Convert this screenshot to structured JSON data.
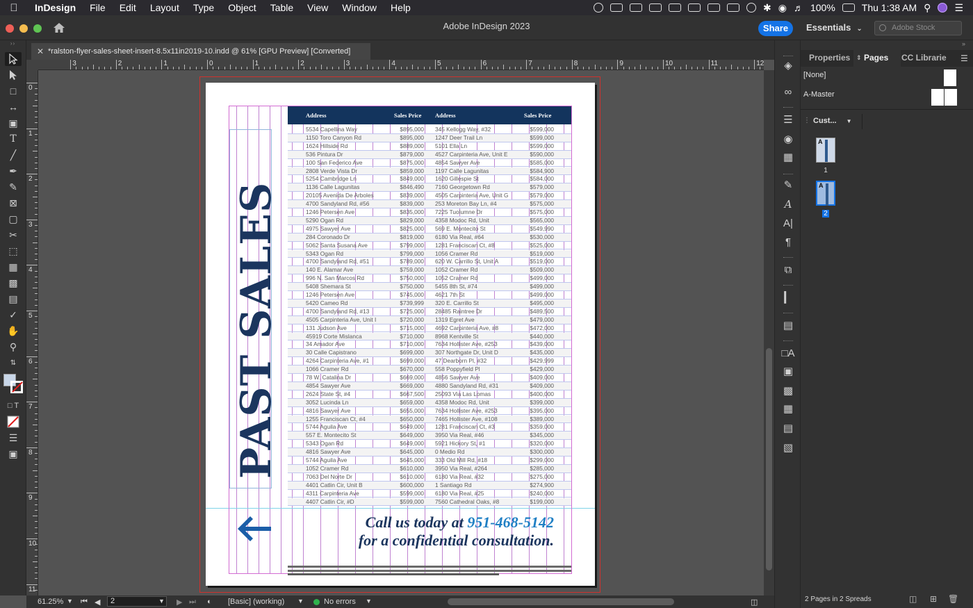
{
  "menubar": {
    "app_name": "InDesign",
    "items": [
      "File",
      "Edit",
      "Layout",
      "Type",
      "Object",
      "Table",
      "View",
      "Window",
      "Help"
    ],
    "battery": "100%",
    "clock": "Thu 1:38 AM"
  },
  "titlebar": {
    "title": "Adobe InDesign 2023",
    "share_label": "Share",
    "workspace": "Essentials",
    "stock_placeholder": "Adobe Stock"
  },
  "document": {
    "tab_title": "*ralston-flyer-sales-sheet-insert-8.5x11in2019-10.indd @ 61% [GPU Preview] [Converted]"
  },
  "rulers": {
    "horizontal_labels": [
      "3",
      "2",
      "1",
      "0",
      "1",
      "2",
      "3",
      "4",
      "5",
      "6",
      "7",
      "8",
      "9",
      "10",
      "11",
      "12"
    ],
    "vertical_labels": [
      "0",
      "1",
      "2",
      "3",
      "4",
      "5",
      "6",
      "7",
      "8",
      "9",
      "10",
      "11"
    ]
  },
  "flyer": {
    "heading": "PAST SALES",
    "table_headers": [
      "Address",
      "Sales Price",
      "Address",
      "Sales Price"
    ],
    "rows": [
      [
        "5534 Capellina Way",
        "$895,000",
        "345 Kellogg Way, #32",
        "$599,000"
      ],
      [
        "1150 Toro Canyon Rd",
        "$895,000",
        "1247 Deer Trail Ln",
        "$599,000"
      ],
      [
        "1624 Hillside Rd",
        "$889,000",
        "5101 Ella Ln",
        "$599,000"
      ],
      [
        "536 Pintura Dr",
        "$879,000",
        "4527 Carpinteria Ave, Unit E",
        "$590,000"
      ],
      [
        "100 San Federico Ave",
        "$875,000",
        "4854 Sawyer Ave",
        "$585,000"
      ],
      [
        "2808 Verde Vista Dr",
        "$859,000",
        "1197 Calle Lagunitas",
        "$584,900"
      ],
      [
        "5254 Cambridge Ln",
        "$849,000",
        "1620 Gillespie St",
        "$584,000"
      ],
      [
        "1136 Calle Lagunitas",
        "$846,490",
        "7160 Georgetown Rd",
        "$579,000"
      ],
      [
        "20105 Avenida De Arboles",
        "$839,000",
        "4505 Carpinteria Ave, Unit G",
        "$579,000"
      ],
      [
        "4700 Sandyland Rd, #56",
        "$839,000",
        "253 Moreton Bay Ln, #4",
        "$575,000"
      ],
      [
        "1246 Petersen Ave",
        "$835,000",
        "7225 Tuolumne Dr",
        "$575,000"
      ],
      [
        "5290 Ogan Rd",
        "$829,000",
        "4358 Modoc Rd, Unit",
        "$565,000"
      ],
      [
        "4975 Sawyer Ave",
        "$825,000",
        "569 E. Montecito St",
        "$549,990"
      ],
      [
        "284 Coronado Dr",
        "$819,000",
        "6180 Via Real, #64",
        "$530,000"
      ],
      [
        "5062 Santa Susana Ave",
        "$799,000",
        "1281 Franciscan Ct, #8",
        "$525,000"
      ],
      [
        "5343 Ogan Rd",
        "$799,000",
        "1056 Cramer Rd",
        "$519,000"
      ],
      [
        "4700 Sandyland Rd, #51",
        "$789,000",
        "620 W. Carrillo St, Unit A",
        "$519,000"
      ],
      [
        "140 E. Alamar Ave",
        "$759,000",
        "1052 Cramer Rd",
        "$509,000"
      ],
      [
        "996 N. San Marcos Rd",
        "$750,000",
        "1052 Cramer Rd",
        "$499,000"
      ],
      [
        "5408 Shemara St",
        "$750,000",
        "5455 8th St, #74",
        "$499,000"
      ],
      [
        "1246 Petersen Ave",
        "$745,000",
        "4621 7th St",
        "$499,000"
      ],
      [
        "5420 Cameo Rd",
        "$739,999",
        "320 E. Carrillo St",
        "$495,000"
      ],
      [
        "4700 Sandyland Rd, #13",
        "$725,000",
        "28485 Raintree Dr",
        "$489,500"
      ],
      [
        "4505 Carpinteria Ave, Unit I",
        "$720,000",
        "1319 Egret Ave",
        "$479,000"
      ],
      [
        "131 Judson Ave",
        "$715,000",
        "4692 Carpinteria Ave, #8",
        "$472,000"
      ],
      [
        "45919 Corte Mislanca",
        "$710,000",
        "8968 Kentville St",
        "$440,000"
      ],
      [
        "34 Amador Ave",
        "$710,000",
        "7634 Hollister Ave, #253",
        "$439,000"
      ],
      [
        "30 Calle Capistrano",
        "$699,000",
        "307 Northgate Dr, Unit D",
        "$435,000"
      ],
      [
        "4264 Carpinteria Ave, #1",
        "$699,000",
        "47 Dearborn Pl, #32",
        "$429,999"
      ],
      [
        "1066 Cramer Rd",
        "$670,000",
        "558 Poppyfield Pl",
        "$429,000"
      ],
      [
        "78 W. Catalina Dr",
        "$669,000",
        "4856 Sawyer Ave",
        "$409,000"
      ],
      [
        "4854 Sawyer Ave",
        "$669,000",
        "4880 Sandyland Rd, #31",
        "$409,000"
      ],
      [
        "2624 State St, #4",
        "$667,500",
        "25093 Via Las Lomas",
        "$400,000"
      ],
      [
        "3052 Lucinda Ln",
        "$659,000",
        "4358 Modoc Rd, Unit",
        "$399,000"
      ],
      [
        "4816 Sawyer Ave",
        "$655,000",
        "7634 Hollister Ave, #253",
        "$395,000"
      ],
      [
        "1255 Franciscan Ct, #4",
        "$650,000",
        "7465 Hollister Ave, #108",
        "$389,000"
      ],
      [
        "5744 Aguila Ave",
        "$649,000",
        "1281 Franciscan Ct, #3",
        "$359,000"
      ],
      [
        "557 E. Montecito St",
        "$649,000",
        "3950 Via Real, #46",
        "$345,000"
      ],
      [
        "5343 Ogan Rd",
        "$649,000",
        "5921 Hickory St, #1",
        "$320,000"
      ],
      [
        "4816 Sawyer Ave",
        "$645,000",
        "0 Medio Rd",
        "$300,000"
      ],
      [
        "5744 Aguila Ave",
        "$645,000",
        "333 Old Mill Rd, #18",
        "$299,000"
      ],
      [
        "1052 Cramer Rd",
        "$610,000",
        "3950 Via Real, #264",
        "$285,000"
      ],
      [
        "7063 Del Norte Dr",
        "$610,000",
        "6180 Via Real, #32",
        "$275,000"
      ],
      [
        "4401 Catlin Cir, Unit B",
        "$600,000",
        "1 Santiago Rd",
        "$274,900"
      ],
      [
        "4311 Carpinteria Ave",
        "$599,000",
        "6180 Via Real, #25",
        "$240,000"
      ],
      [
        "4407 Catlin Cir, #D",
        "$599,000",
        "7560 Cathedral Oaks, #8",
        "$199,000"
      ]
    ],
    "cta_line1_text": "Call us today at",
    "cta_phone": "951-468-5142",
    "cta_line2": "for a confidential consultation.",
    "colors": {
      "navy": "#13345d",
      "accent_blue": "#1f7fc4"
    }
  },
  "statusbar": {
    "zoom": "61.25%",
    "page_field": "2",
    "preflight_profile": "[Basic] (working)",
    "errors": "No errors"
  },
  "pages_panel": {
    "tabs": [
      "Properties",
      "Pages",
      "CC Librarie"
    ],
    "masters": [
      "[None]",
      "A-Master"
    ],
    "size_selector": "Cust...",
    "pages": [
      {
        "label": "1",
        "master": "A"
      },
      {
        "label": "2",
        "master": "A"
      }
    ],
    "page_count": "2 Pages in 2 Spreads"
  }
}
